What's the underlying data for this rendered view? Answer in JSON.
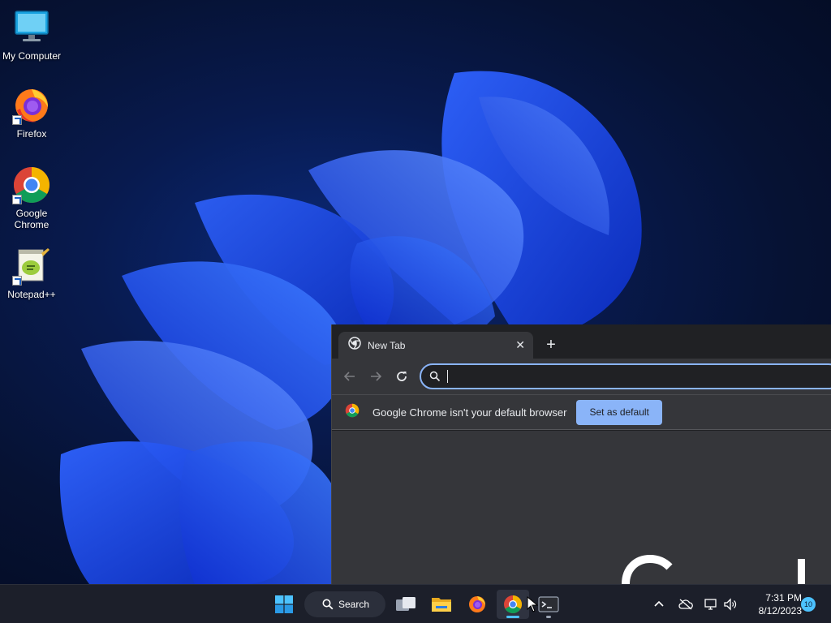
{
  "desktop": {
    "icons": [
      {
        "label": "My Computer",
        "icon": "monitor-icon"
      },
      {
        "label": "Firefox",
        "icon": "firefox-icon"
      },
      {
        "label": "Google Chrome",
        "icon": "chrome-icon"
      },
      {
        "label": "Notepad++",
        "icon": "notepadpp-icon"
      }
    ]
  },
  "browser": {
    "tab_title": "New Tab",
    "tab_close": "✕",
    "new_tab": "+",
    "omnibox_value": "",
    "infobar_text": "Google Chrome isn't your default browser",
    "set_default_label": "Set as default",
    "accent": "#8ab4f8"
  },
  "taskbar": {
    "search_label": "Search",
    "time": "7:31 PM",
    "date": "8/12/2023",
    "notification_count": "10",
    "accent": "#4cc2ff",
    "apps": [
      "start-icon",
      "task-view-icon",
      "file-explorer-icon",
      "firefox-icon",
      "chrome-icon",
      "terminal-icon"
    ]
  }
}
